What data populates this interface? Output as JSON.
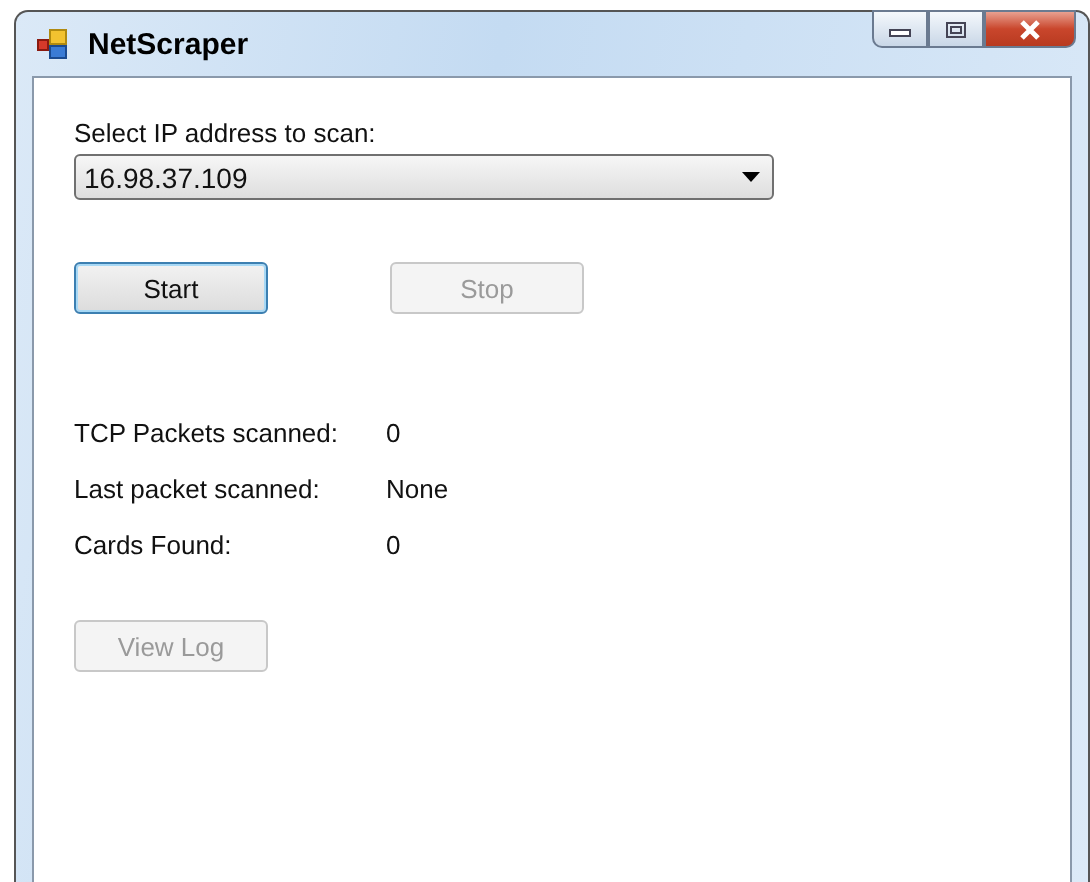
{
  "window": {
    "title": "NetScraper"
  },
  "ip_select": {
    "label": "Select IP address to scan:",
    "value": "16.98.37.109"
  },
  "actions": [
    {
      "label": "Start",
      "disabled": false,
      "focused": true
    },
    {
      "label": "Stop",
      "disabled": true,
      "focused": false
    }
  ],
  "stats": [
    {
      "label": "TCP Packets scanned:",
      "value": "0"
    },
    {
      "label": "Last packet scanned:",
      "value": "None"
    },
    {
      "label": "Cards Found:",
      "value": "0"
    }
  ],
  "log_button": {
    "label": "View Log",
    "disabled": true
  }
}
